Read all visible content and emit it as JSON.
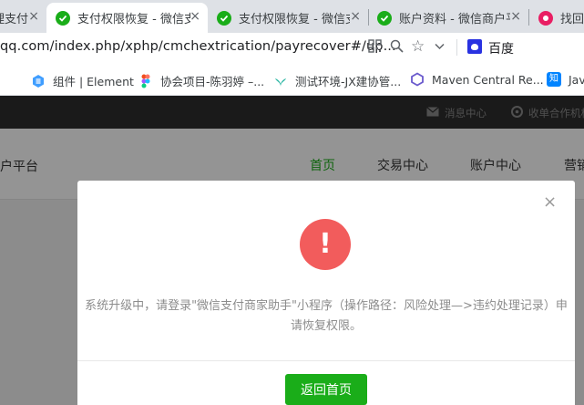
{
  "tabs": [
    {
      "title": "理支付"
    },
    {
      "title": "支付权限恢复 - 微信支付"
    },
    {
      "title": "支付权限恢复 - 微信支付"
    },
    {
      "title": "账户资料 - 微信商户平台"
    },
    {
      "title": "找回"
    }
  ],
  "tab_close_glyph": "×",
  "address": {
    "url": "qq.com/index.php/xphp/cmchextrication/payrecover#/up..."
  },
  "search_engine": "百度",
  "bookmarks": [
    {
      "label": "组件 | Element"
    },
    {
      "label": "协会项目-陈羽婷 –..."
    },
    {
      "label": "测试环境-JX建协管..."
    },
    {
      "label": "Maven Central Re..."
    },
    {
      "label": "Jav"
    }
  ],
  "bookmark_zhihu_glyph": "知",
  "topbar": {
    "messages": "消息中心",
    "partner": "收单合作机构"
  },
  "nav": {
    "brand": "商户平台",
    "links": [
      {
        "label": "首页"
      },
      {
        "label": "交易中心"
      },
      {
        "label": "账户中心"
      },
      {
        "label": "营销"
      }
    ]
  },
  "modal": {
    "close_glyph": "×",
    "alert_glyph": "!",
    "message": "系统升级中，请登录\"微信支付商家助手\"小程序（操作路径：风险处理—>违约处理记录）申请恢复权限。",
    "button_label": "返回首页"
  },
  "colors": {
    "accent": "#1aad19",
    "alert": "#f25c5c"
  }
}
